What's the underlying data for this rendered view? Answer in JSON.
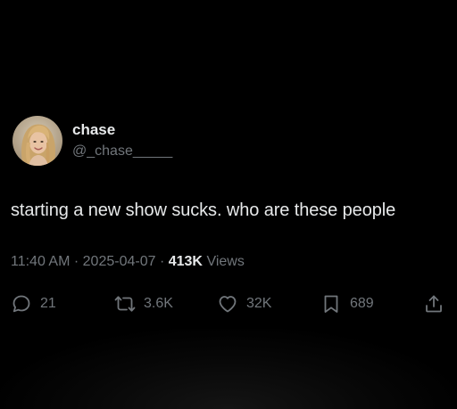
{
  "user": {
    "display_name": "chase",
    "handle": "@_chase_____",
    "avatar_icon": "profile-photo"
  },
  "tweet": {
    "text": "starting a new show sucks. who are these people",
    "time": "11:40 AM",
    "separator": "·",
    "date": "2025-04-07",
    "views_count": "413K",
    "views_label": "Views"
  },
  "actions": {
    "replies": "21",
    "reposts": "3.6K",
    "likes": "32K",
    "bookmarks": "689"
  },
  "colors": {
    "background": "#000000",
    "text_primary": "#e7e9ea",
    "text_secondary": "#71767b"
  }
}
